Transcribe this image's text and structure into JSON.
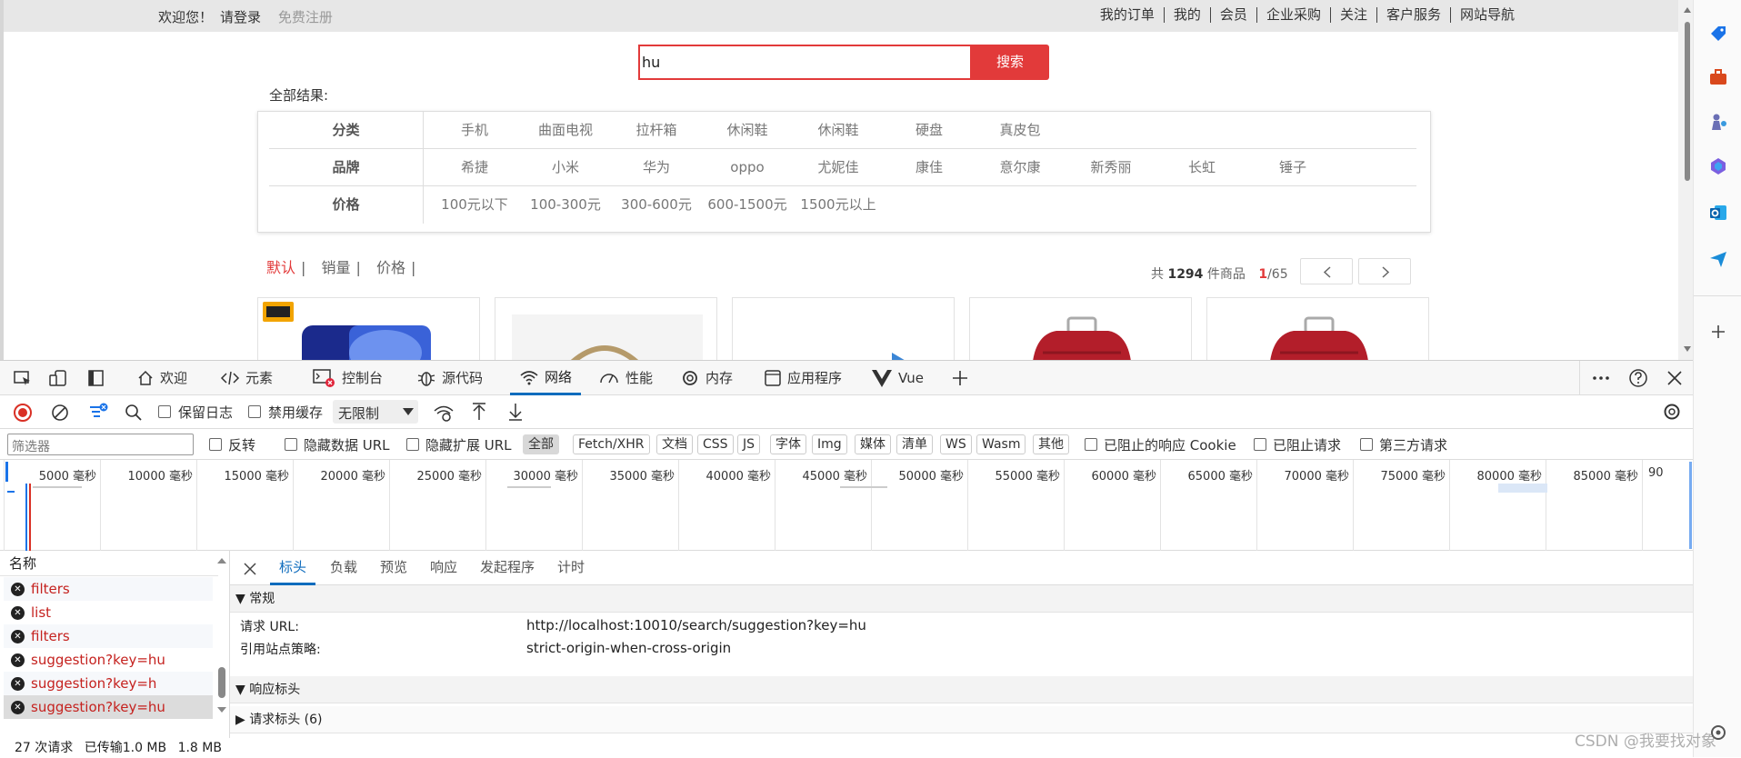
{
  "site": {
    "top_left": {
      "welcome": "欢迎您！",
      "login": "请登录",
      "register": "免费注册"
    },
    "top_nav": [
      "我的订单",
      "我的",
      "会员",
      "企业采购",
      "关注",
      "客户服务",
      "网站导航"
    ],
    "search": {
      "value": "hu",
      "button": "搜索"
    },
    "all_results": "全部结果:",
    "filters": {
      "category": {
        "label": "分类",
        "values": [
          "手机",
          "曲面电视",
          "拉杆箱",
          "休闲鞋",
          "休闲鞋",
          "硬盘",
          "真皮包"
        ]
      },
      "brand": {
        "label": "品牌",
        "values": [
          "希捷",
          "小米",
          "华为",
          "oppo",
          "尤妮佳",
          "康佳",
          "意尔康",
          "新秀丽",
          "长虹",
          "锤子"
        ]
      },
      "price": {
        "label": "价格",
        "values": [
          "100元以下",
          "100-300元",
          "300-600元",
          "600-1500元",
          "1500元以上"
        ]
      }
    },
    "sort": [
      "默认",
      "销量",
      "价格"
    ],
    "pagination": {
      "prefix": "共",
      "total": "1294",
      "suffix": "件商品",
      "current": "1",
      "pages": "/65"
    }
  },
  "devtools": {
    "tabs": [
      "欢迎",
      "元素",
      "控制台",
      "源代码",
      "网络",
      "性能",
      "内存",
      "应用程序",
      "Vue"
    ],
    "toolbar": {
      "preserve_log": "保留日志",
      "disable_cache": "禁用缓存",
      "throttle": "无限制"
    },
    "filter": {
      "placeholder": "筛选器",
      "invert": "反转",
      "hide_data_url": "隐藏数据 URL",
      "hide_ext_url": "隐藏扩展 URL",
      "types": [
        "全部",
        "Fetch/XHR",
        "文档",
        "CSS",
        "JS",
        "字体",
        "Img",
        "媒体",
        "清单",
        "WS",
        "Wasm",
        "其他"
      ],
      "blocked_cookie": "已阻止的响应 Cookie",
      "blocked_req": "已阻止请求",
      "third_party": "第三方请求"
    },
    "timeline_ticks": [
      "5000 毫秒",
      "10000 毫秒",
      "15000 毫秒",
      "20000 毫秒",
      "25000 毫秒",
      "30000 毫秒",
      "35000 毫秒",
      "40000 毫秒",
      "45000 毫秒",
      "50000 毫秒",
      "55000 毫秒",
      "60000 毫秒",
      "65000 毫秒",
      "70000 毫秒",
      "75000 毫秒",
      "80000 毫秒",
      "85000 毫秒",
      "90"
    ],
    "list": {
      "header": "名称",
      "items": [
        "filters",
        "list",
        "filters",
        "suggestion?key=hu",
        "suggestion?key=h",
        "suggestion?key=hu"
      ]
    },
    "status": {
      "requests": "27 次请求",
      "transferred": "已传输1.0 MB",
      "resources": "1.8 MB"
    },
    "detail_tabs": [
      "标头",
      "负载",
      "预览",
      "响应",
      "发起程序",
      "计时"
    ],
    "general": {
      "title": "常规",
      "url_label": "请求 URL:",
      "url_value": "http://localhost:10010/search/suggestion?key=hu",
      "policy_label": "引用站点策略:",
      "policy_value": "strict-origin-when-cross-origin"
    },
    "response_headers": "响应标头",
    "request_headers": "请求标头 (6)"
  },
  "watermark": "CSDN @我要找对象",
  "colors": {
    "accent_red": "#e23a3a",
    "devtools_blue": "#0f6cbd",
    "error_red": "#c5221f"
  }
}
